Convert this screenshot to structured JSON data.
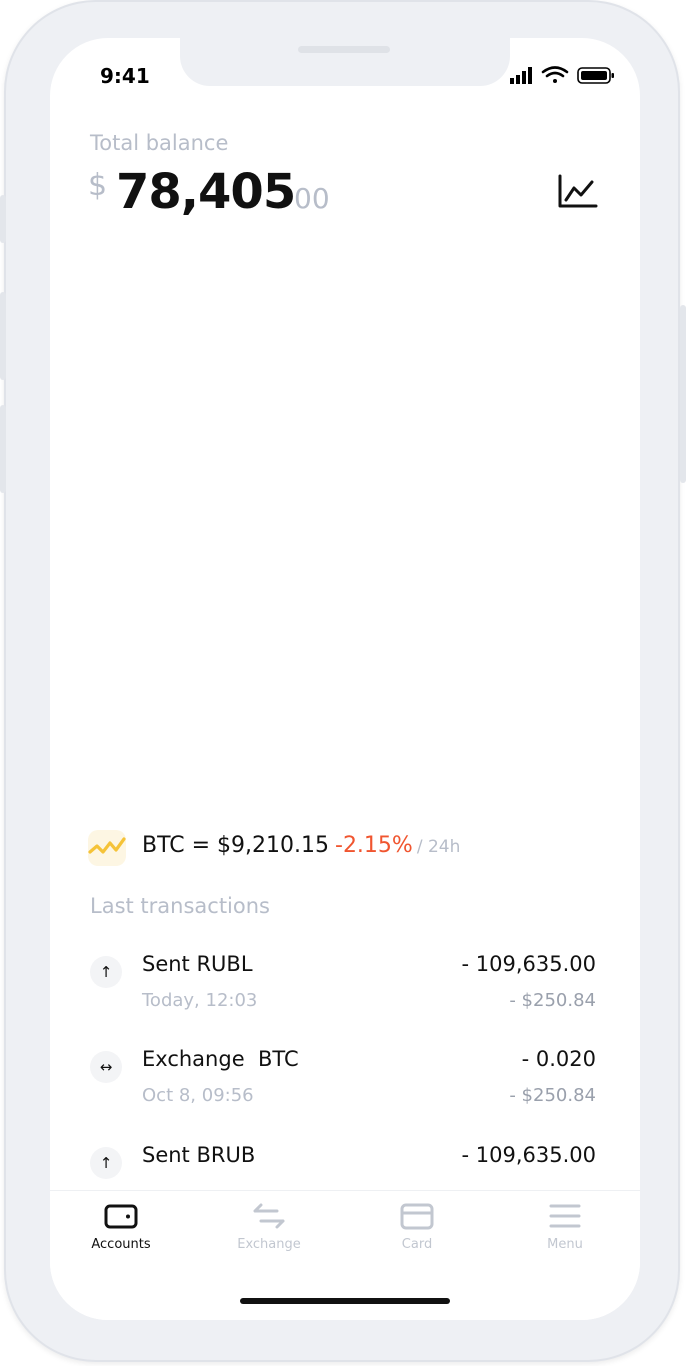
{
  "status_bar": {
    "time": "9:41"
  },
  "balance": {
    "label": "Total balance",
    "currency": "$",
    "amount": "78,405",
    "cents": "00"
  },
  "ticker": {
    "text": "BTC = $9,210.15",
    "change": "-2.15%",
    "period": "/ 24h",
    "change_color": "#f0552f"
  },
  "transactions_section": {
    "title": "Last transactions",
    "items": [
      {
        "icon": "arrow-up-icon",
        "title": "Sent RUBL",
        "amount": "- 109,635.00",
        "time": "Today, 12:03",
        "usd": "- $250.84"
      },
      {
        "icon": "exchange-icon",
        "title": "Exchange  BTC",
        "amount": "- 0.020",
        "time": "Oct 8, 09:56",
        "usd": "- $250.84"
      },
      {
        "icon": "arrow-up-icon",
        "title": "Sent BRUB",
        "amount": "- 109,635.00",
        "time": "",
        "usd": ""
      }
    ]
  },
  "tabbar": {
    "tabs": [
      {
        "label": "Accounts",
        "icon": "wallet-icon",
        "active": true
      },
      {
        "label": "Exchange",
        "icon": "exchange-arrows-icon",
        "active": false
      },
      {
        "label": "Card",
        "icon": "card-icon",
        "active": false
      },
      {
        "label": "Menu",
        "icon": "menu-icon",
        "active": false
      }
    ]
  },
  "colors": {
    "accent_negative": "#f0552f",
    "muted_text": "#b7bdc9",
    "ticker_icon": "#f5c338"
  }
}
